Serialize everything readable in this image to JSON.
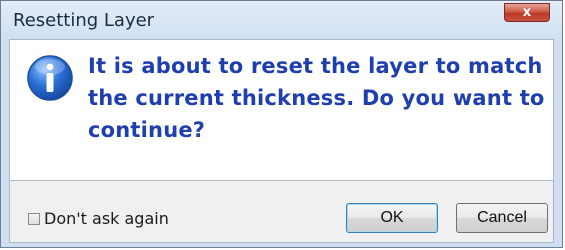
{
  "window": {
    "title": "Resetting Layer",
    "close_glyph": "x"
  },
  "dialog": {
    "icon": "info-icon",
    "message": "It is about to reset the layer to match the current thickness. Do you want to continue?",
    "message_color": "#1f3fae"
  },
  "footer": {
    "checkbox_label": "Don't ask again",
    "checkbox_checked": false,
    "ok_label": "OK",
    "cancel_label": "Cancel"
  }
}
